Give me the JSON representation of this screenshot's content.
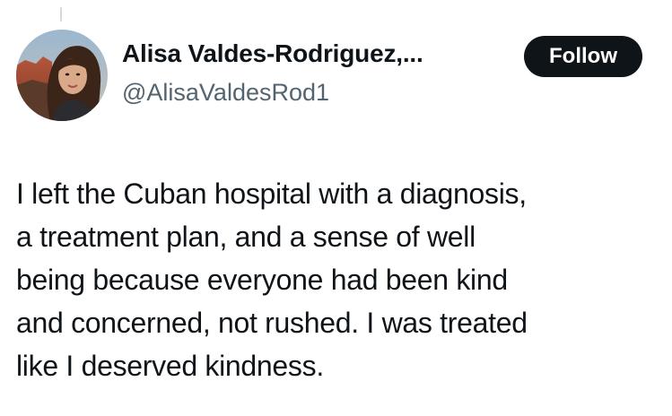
{
  "author": {
    "display_name": "Alisa Valdes-Rodriguez,...",
    "handle": "@AlisaValdesRod1",
    "avatar": "profile-photo"
  },
  "actions": {
    "follow_label": "Follow"
  },
  "tweet": {
    "lines": [
      "I left the Cuban hospital with a diagnosis,",
      "a treatment plan, and a sense of well",
      "being because everyone had been kind",
      "and concerned, not rushed. I was treated",
      "like I deserved kindness."
    ]
  },
  "colors": {
    "text": "#0f1419",
    "secondary_text": "#536471",
    "button_bg": "#0f1419",
    "button_text": "#ffffff",
    "thread_line": "#cfd9de"
  }
}
